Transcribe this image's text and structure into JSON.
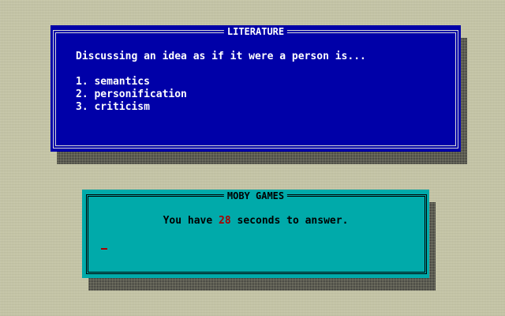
{
  "question_window": {
    "title": "LITERATURE",
    "question": "Discussing an idea as if it were a person is...",
    "answers": [
      "1. semantics",
      "2. personification",
      "3. criticism"
    ],
    "colors": {
      "background": "#0000a8",
      "text": "#ffffff"
    }
  },
  "timer_window": {
    "title": "MOBY GAMES",
    "prefix": "You have ",
    "seconds": "28",
    "suffix": " seconds to answer.",
    "colors": {
      "background": "#00aaaa",
      "text": "#000000",
      "seconds": "#a80000"
    }
  }
}
